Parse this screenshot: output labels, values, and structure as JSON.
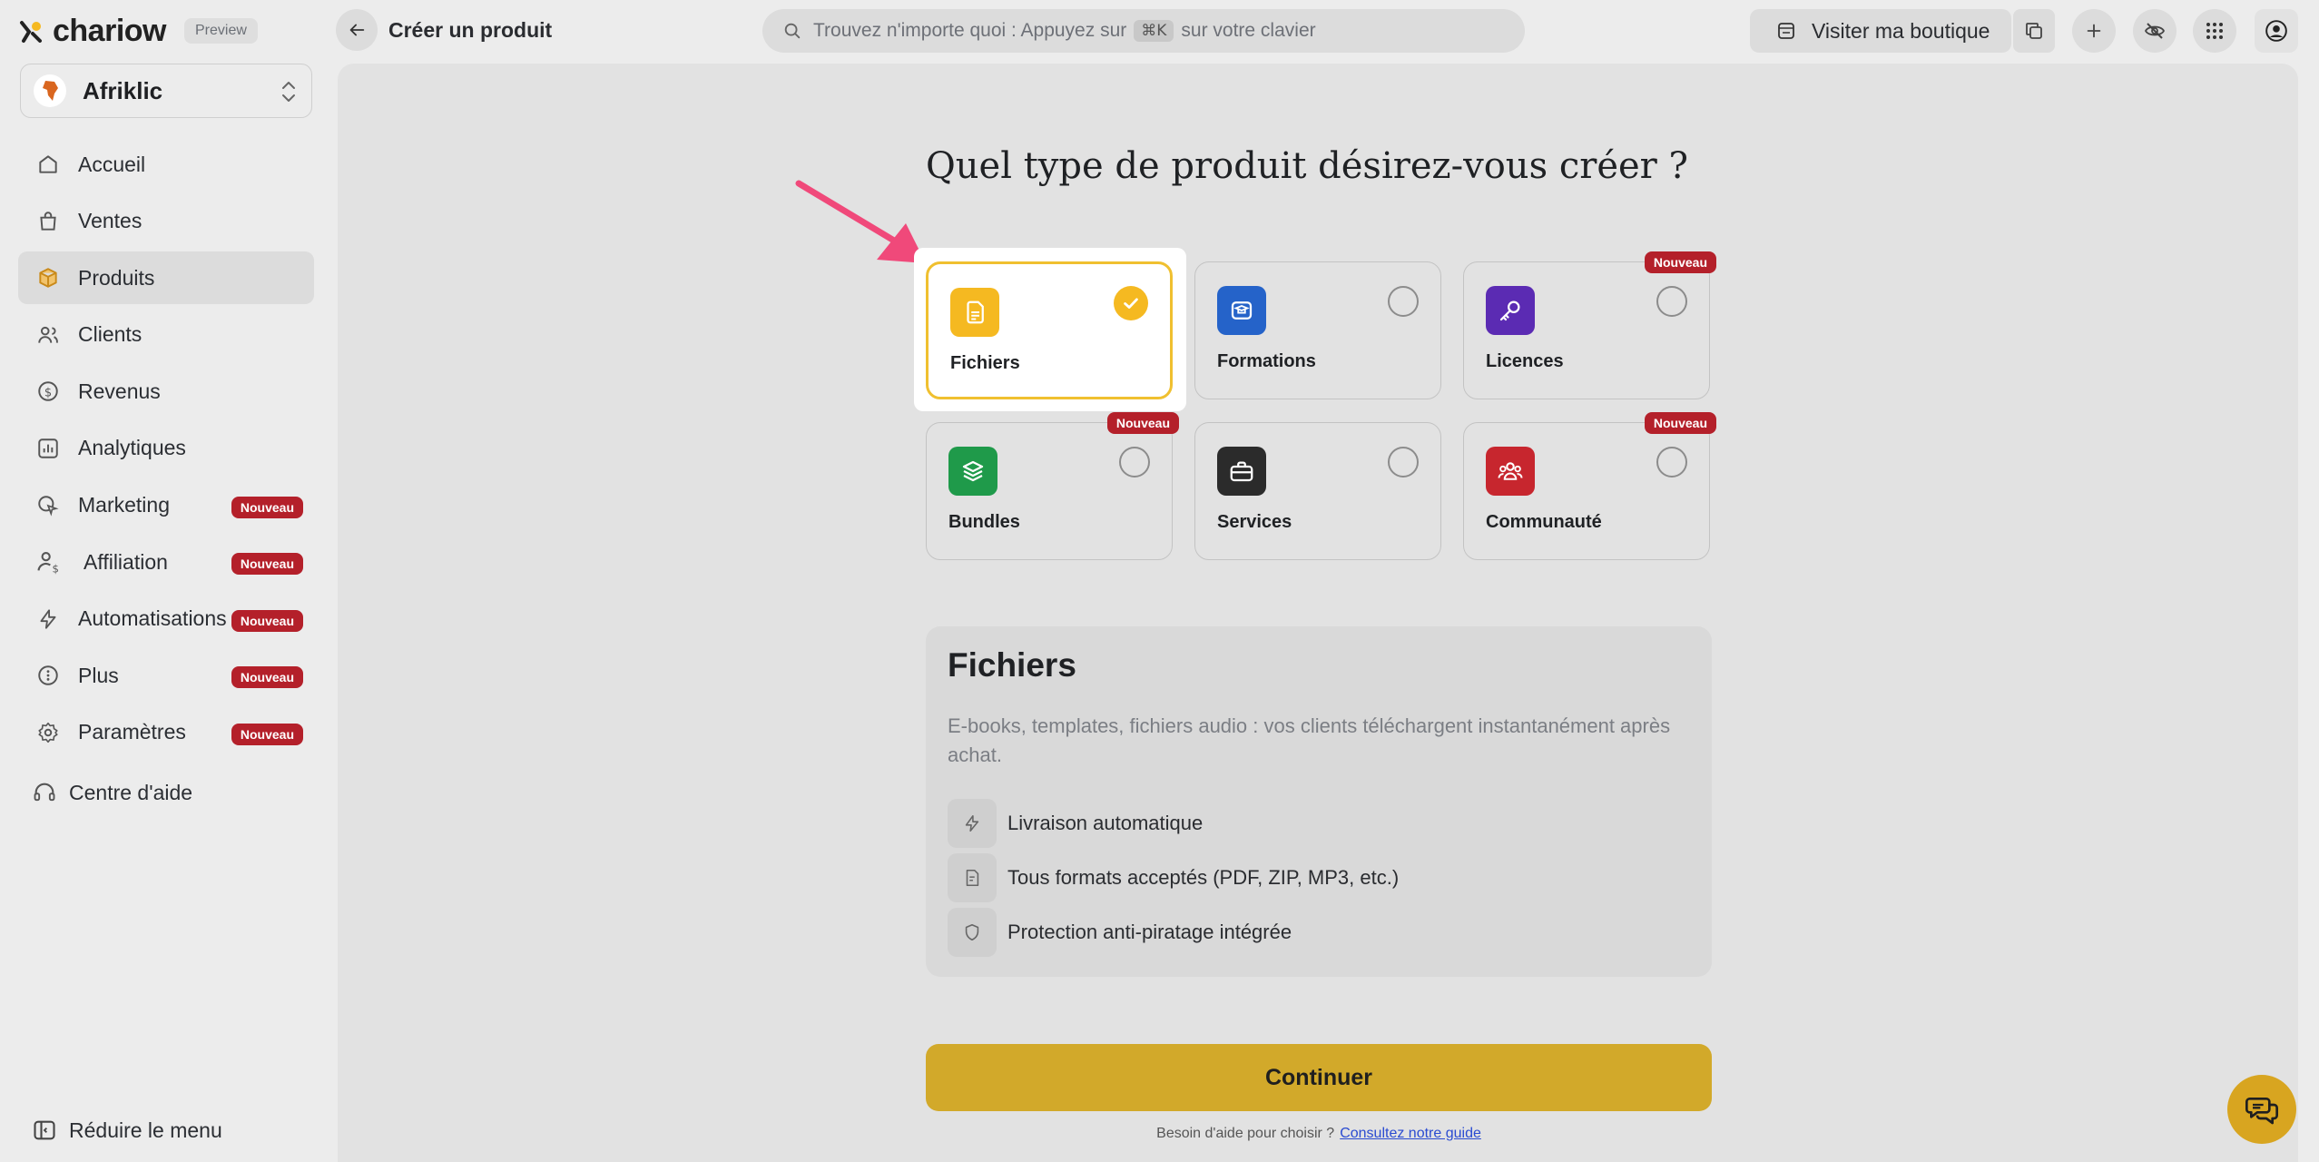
{
  "brand": {
    "name": "chariow",
    "preview": "Preview"
  },
  "store": {
    "name": "Afriklic"
  },
  "sidebar": {
    "items": [
      {
        "label": "Accueil",
        "icon": "home-icon"
      },
      {
        "label": "Ventes",
        "icon": "shopping-bag-icon"
      },
      {
        "label": "Produits",
        "icon": "box-icon",
        "active": true
      },
      {
        "label": "Clients",
        "icon": "users-icon"
      },
      {
        "label": "Revenus",
        "icon": "dollar-circle-icon"
      },
      {
        "label": "Analytiques",
        "icon": "chart-icon"
      },
      {
        "label": "Marketing",
        "icon": "cursor-icon",
        "badge": "Nouveau"
      },
      {
        "label": "Affiliation",
        "icon": "affiliate-user-icon",
        "badge": "Nouveau"
      },
      {
        "label": "Automatisations",
        "icon": "bolt-icon",
        "badge": "Nouveau"
      },
      {
        "label": "Plus",
        "icon": "more-circle-icon",
        "badge": "Nouveau"
      },
      {
        "label": "Paramètres",
        "icon": "gear-icon",
        "badge": "Nouveau"
      }
    ],
    "help": "Centre d'aide",
    "reduce": "Réduire le menu"
  },
  "topbar": {
    "title": "Créer un produit",
    "search_prefix": "Trouvez n'importe quoi : Appuyez sur",
    "search_kbd": "⌘K",
    "search_suffix": "sur votre clavier",
    "visit": "Visiter ma boutique"
  },
  "main": {
    "heading": "Quel type de produit désirez-vous créer ?",
    "types": [
      {
        "label": "Fichiers",
        "icon": "file-icon",
        "color": "#f5b921",
        "selected": true
      },
      {
        "label": "Formations",
        "icon": "graduation-icon",
        "color": "#2563c9"
      },
      {
        "label": "Licences",
        "icon": "key-icon",
        "color": "#5b2bb3",
        "badge": "Nouveau"
      },
      {
        "label": "Bundles",
        "icon": "layers-icon",
        "color": "#1f9a4a",
        "badge": "Nouveau"
      },
      {
        "label": "Services",
        "icon": "briefcase-icon",
        "color": "#2b2b2b"
      },
      {
        "label": "Communauté",
        "icon": "community-icon",
        "color": "#c7262e",
        "badge": "Nouveau"
      }
    ],
    "info": {
      "title": "Fichiers",
      "description": "E-books, templates, fichiers audio : vos clients téléchargent instantanément après achat.",
      "features": [
        {
          "label": "Livraison automatique",
          "icon": "bolt-icon"
        },
        {
          "label": "Tous formats acceptés (PDF, ZIP, MP3, etc.)",
          "icon": "document-icon"
        },
        {
          "label": "Protection anti-piratage intégrée",
          "icon": "shield-icon"
        }
      ]
    },
    "continue": "Continuer",
    "help_text": "Besoin d'aide pour choisir ?",
    "help_link": "Consultez notre guide"
  }
}
